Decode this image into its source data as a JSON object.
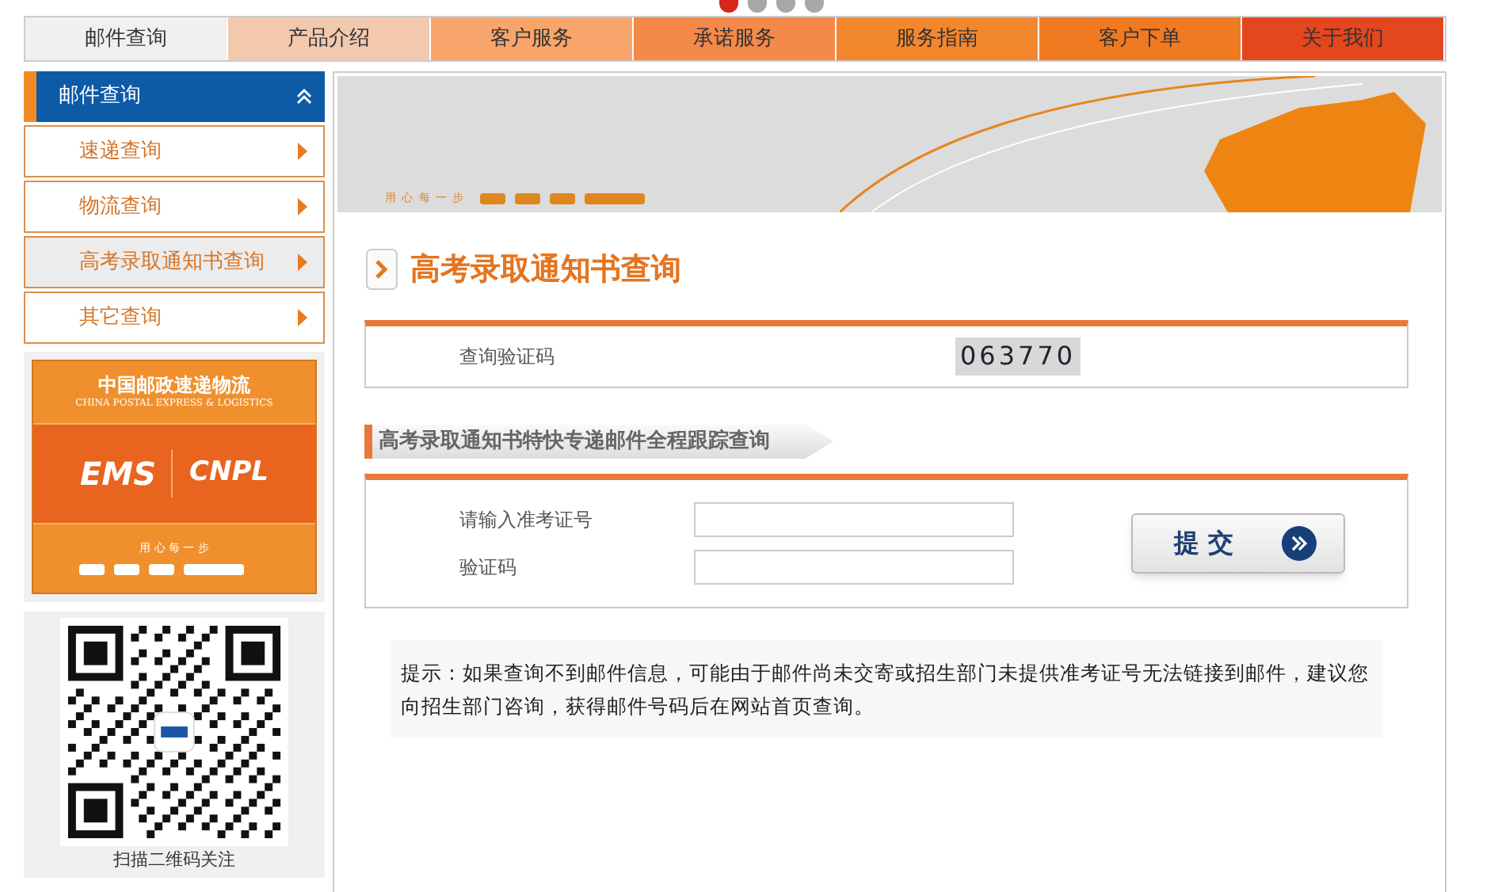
{
  "carousel": {
    "dots": [
      {
        "selected": true
      },
      {
        "selected": false
      },
      {
        "selected": false
      },
      {
        "selected": false
      }
    ]
  },
  "nav": [
    {
      "label": "邮件查询",
      "color": "#f0f0f0"
    },
    {
      "label": "产品介绍",
      "color": "#f3c9ae"
    },
    {
      "label": "客户服务",
      "color": "#f7a56b"
    },
    {
      "label": "承诺服务",
      "color": "#f5894a"
    },
    {
      "label": "服务指南",
      "color": "#f3872d"
    },
    {
      "label": "客户下单",
      "color": "#f07a22"
    },
    {
      "label": "关于我们",
      "color": "#e4461f"
    }
  ],
  "sidebar": {
    "title": "邮件查询",
    "expanded": true,
    "items": [
      {
        "label": "速递查询",
        "selected": false
      },
      {
        "label": "物流查询",
        "selected": false
      },
      {
        "label": "高考录取通知书查询",
        "selected": true
      },
      {
        "label": "其它查询",
        "selected": false
      }
    ],
    "logo": {
      "name_cn": "中国邮政速递物流",
      "name_en": "CHINA POSTAL EXPRESS & LOGISTICS",
      "brand_1": "EMS",
      "brand_2": "CNPL",
      "slogan": "用 心 每 一 步"
    },
    "qr_caption": "扫描二维码关注"
  },
  "banner": {
    "slogan": "用 心 每 一 步"
  },
  "page_title": "高考录取通知书查询",
  "captcha": {
    "label": "查询验证码",
    "code": "063770"
  },
  "section_heading": "高考录取通知书特快专递邮件全程跟踪查询",
  "form": {
    "fields": [
      {
        "label": "请输入准考证号"
      },
      {
        "label": "验证码"
      }
    ],
    "submit": "提 交"
  },
  "tip": "提示：如果查询不到邮件信息，可能由于邮件尚未交寄或招生部门未提供准考证号无法链接到邮件，建议您向招生部门咨询，获得邮件号码后在网站首页查询。"
}
